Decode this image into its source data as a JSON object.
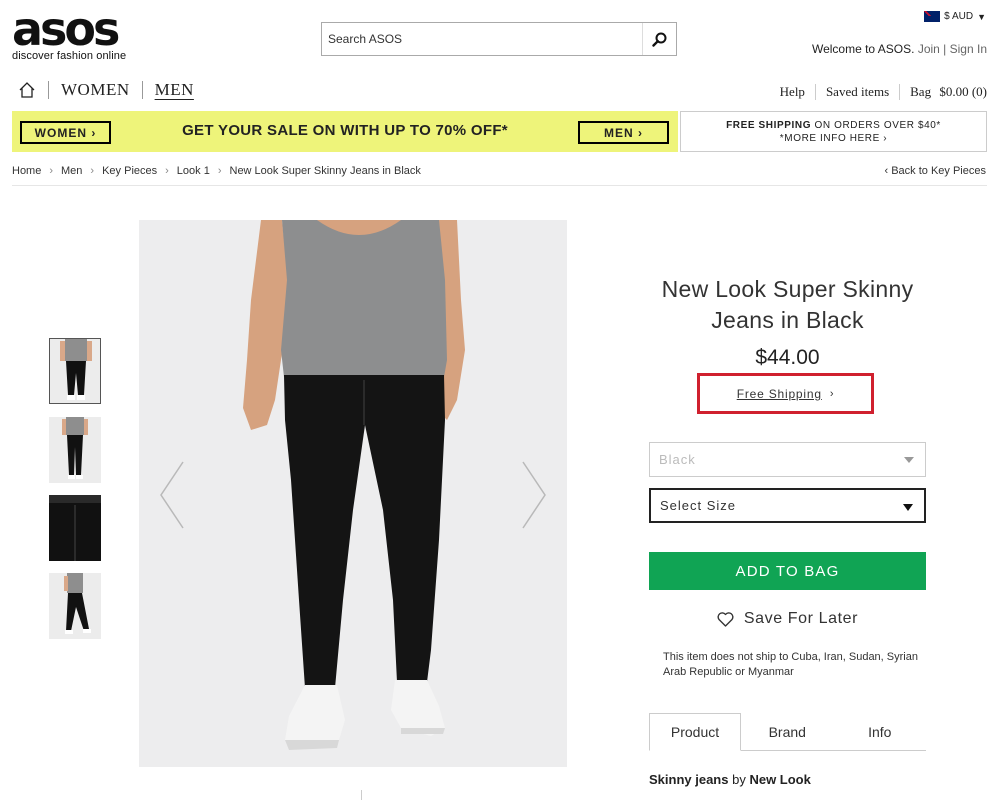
{
  "header": {
    "logo_text": "asos",
    "logo_tagline": "discover fashion online",
    "search_placeholder": "Search ASOS",
    "currency": "$ AUD",
    "welcome_text": "Welcome to ASOS.",
    "join_label": "Join",
    "signin_label": "Sign In",
    "join_separator": "|"
  },
  "nav": {
    "women": "WOMEN",
    "men": "MEN",
    "help": "Help",
    "saved": "Saved items",
    "bag": "Bag",
    "bag_total": "$0.00 (0)"
  },
  "banner": {
    "women_btn": "WOMEN ›",
    "men_btn": "MEN ›",
    "text": "GET YOUR SALE ON WITH UP TO 70% OFF*",
    "ship_bold": "FREE SHIPPING",
    "ship_rest": " ON ORDERS OVER $40*",
    "ship_more": "*MORE INFO HERE ›"
  },
  "breadcrumb": {
    "items": [
      "Home",
      "Men",
      "Key Pieces",
      "Look 1",
      "New Look Super Skinny Jeans in Black"
    ],
    "back": "‹  Back to Key Pieces"
  },
  "product": {
    "title": "New Look Super Skinny Jeans in Black",
    "price": "$44.00",
    "free_shipping": "Free Shipping",
    "free_shipping_chevron": "›",
    "color_select": "Black",
    "size_select": "Select Size",
    "add_to_bag": "ADD TO BAG",
    "save_later": "Save For Later",
    "ship_note": "This item does not ship to Cuba, Iran, Sudan, Syrian Arab Republic or Myanmar",
    "tabs": [
      "Product",
      "Brand",
      "Info"
    ],
    "desc_type": "Skinny jeans",
    "desc_by": " by ",
    "desc_brand": "New Look"
  },
  "colors": {
    "banner_yellow": "#eef47a",
    "add_bag_green": "#10a454",
    "highlight_red": "#d0202e"
  },
  "icons": {
    "search": "magnifier-icon",
    "home": "home-icon",
    "heart": "heart-outline-icon",
    "flag": "australia-flag-icon"
  }
}
